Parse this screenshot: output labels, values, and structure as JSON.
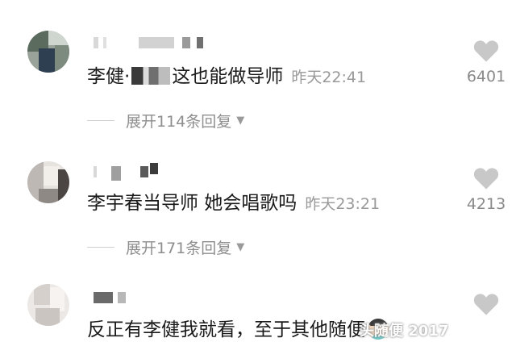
{
  "comments": [
    {
      "text_before": "李健·",
      "text_after": "这也能做导师",
      "time": "昨天22:41",
      "likes": "6401",
      "replies": "展开114条回复"
    },
    {
      "text": "李宇春当导师 她会唱歌吗",
      "time": "昨天23:21",
      "likes": "4213",
      "replies": "展开171条回复"
    },
    {
      "text": "反正有李健我就看，至于其他随便"
    }
  ],
  "watermark": "头随便  2017",
  "colors": {
    "heart": "#c8c8c8",
    "time": "#999999",
    "reply": "#8e8e8e"
  }
}
